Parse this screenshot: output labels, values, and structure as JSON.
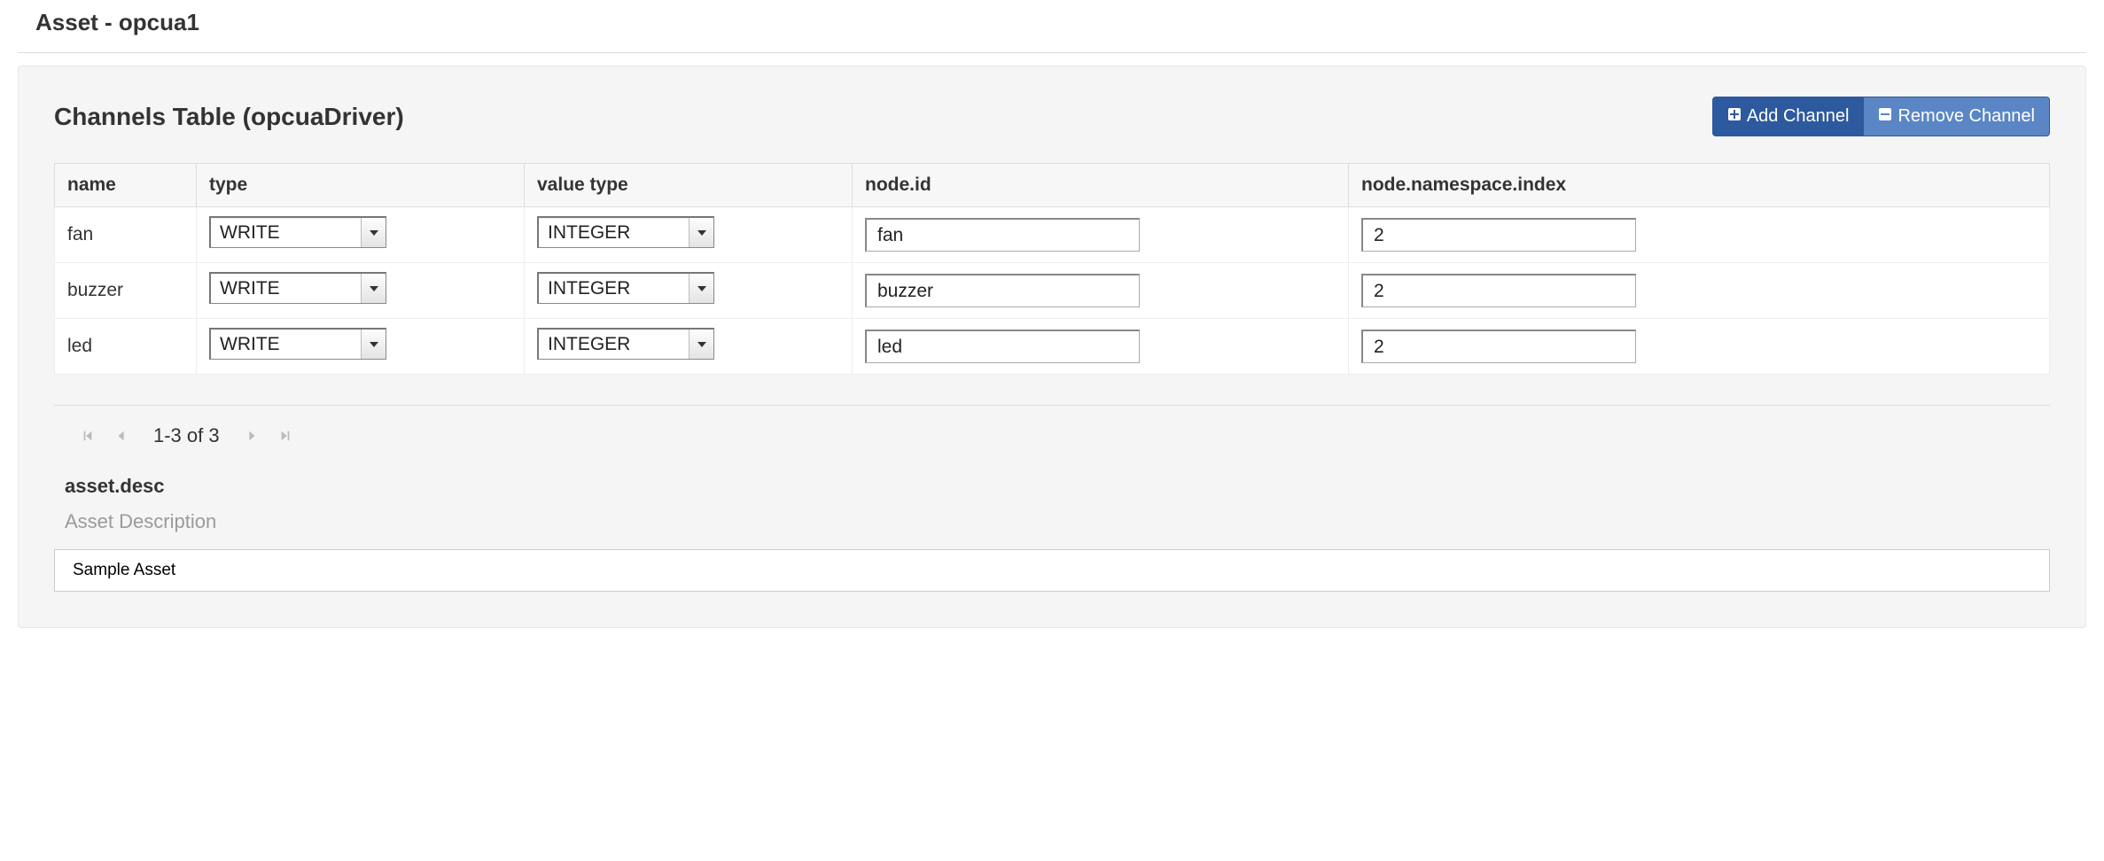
{
  "page_title": "Asset - opcua1",
  "panel": {
    "title": "Channels Table (opcuaDriver)"
  },
  "buttons": {
    "add": "Add Channel",
    "remove": "Remove Channel"
  },
  "columns": {
    "name": "name",
    "type": "type",
    "value_type": "value type",
    "node_id": "node.id",
    "ns_index": "node.namespace.index"
  },
  "rows": [
    {
      "name": "fan",
      "type": "WRITE",
      "value_type": "INTEGER",
      "node_id": "fan",
      "ns_index": "2"
    },
    {
      "name": "buzzer",
      "type": "WRITE",
      "value_type": "INTEGER",
      "node_id": "buzzer",
      "ns_index": "2"
    },
    {
      "name": "led",
      "type": "WRITE",
      "value_type": "INTEGER",
      "node_id": "led",
      "ns_index": "2"
    }
  ],
  "pager": {
    "range": "1-3 of 3"
  },
  "asset_desc": {
    "label": "asset.desc",
    "help": "Asset Description",
    "value": "Sample Asset"
  }
}
